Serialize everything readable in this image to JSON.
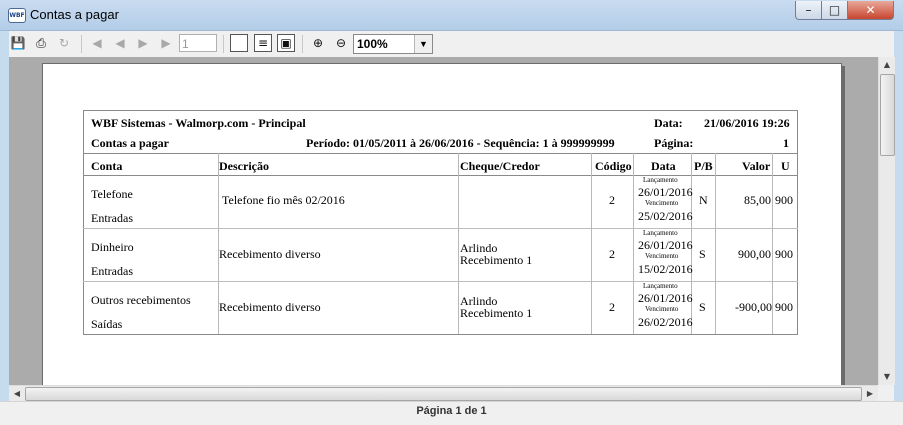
{
  "window": {
    "title": "Contas a pagar",
    "app_icon_text": "WBF"
  },
  "toolbar": {
    "page_input_value": "1",
    "zoom_value": "100%"
  },
  "report": {
    "company": "WBF Sistemas - Walmorp.com - Principal",
    "date_label": "Data:",
    "date_value": "21/06/2016 19:26",
    "title": "Contas a pagar",
    "period": "Período: 01/05/2011 à 26/06/2016  -  Sequência: 1 à 999999999",
    "page_label": "Página:",
    "page_value": "1",
    "columns": [
      "Conta",
      "Descrição",
      "Cheque/Credor",
      "Código",
      "Data",
      "P/B",
      "Valor",
      "U"
    ],
    "rows": [
      {
        "conta": "Telefone",
        "sub": "Entradas",
        "descricao": "Telefone fio mês 02/2016",
        "cheque1": "",
        "cheque2": "",
        "codigo": "2",
        "lanc_label": "Lançamento",
        "lanc_date": "26/01/2016",
        "venc_label": "Vencimento",
        "venc_date": "25/02/2016",
        "pb": "N",
        "valor": "85,00",
        "u": "900"
      },
      {
        "conta": "Dinheiro",
        "sub": "Entradas",
        "descricao": "Recebimento diverso",
        "cheque1": "Arlindo",
        "cheque2": "Recebimento 1",
        "codigo": "2",
        "lanc_label": "Lançamento",
        "lanc_date": "26/01/2016",
        "venc_label": "Vencimento",
        "venc_date": "15/02/2016",
        "pb": "S",
        "valor": "900,00",
        "u": "900"
      },
      {
        "conta": "Outros recebimentos",
        "sub": "Saídas",
        "descricao": "Recebimento diverso",
        "cheque1": "Arlindo",
        "cheque2": "Recebimento 1",
        "codigo": "2",
        "lanc_label": "Lançamento",
        "lanc_date": "26/01/2016",
        "venc_label": "Vencimento",
        "venc_date": "26/02/2016",
        "pb": "S",
        "valor": "-900,00",
        "u": "900"
      }
    ]
  },
  "status": {
    "text": "Página 1 de 1"
  },
  "icons": [
    "save-icon",
    "print-icon",
    "refresh-icon",
    "first-page-icon",
    "previous-page-icon",
    "next-page-icon",
    "last-page-icon",
    "single-page-icon",
    "fit-width-icon",
    "multi-page-icon",
    "zoom-in-icon",
    "zoom-out-icon",
    "chevron-down-icon",
    "close-icon",
    "minimize-icon",
    "maximize-icon"
  ]
}
